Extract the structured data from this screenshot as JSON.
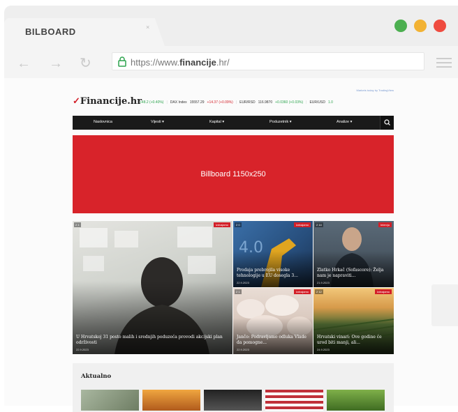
{
  "browser": {
    "tab_title": "BILBOARD",
    "tab_close": "×",
    "url_prefix": "https://www.",
    "url_domain": "financije",
    "url_suffix": ".hr/",
    "back": "←",
    "forward": "→",
    "reload": "↻",
    "dot_colors": [
      "#4caf50",
      "#f2b233",
      "#ef4b3f"
    ]
  },
  "site": {
    "ads_by": "Markets today by TradingView",
    "logo_text": "Financije.hr",
    "ticker": [
      {
        "label": "",
        "value": "",
        "change": "+48.2 (+0.40%)",
        "dir": "up"
      },
      {
        "label": "DAX Index",
        "value": "15557.29",
        "change": "+14.37 (+0.09%)",
        "dir": "down"
      },
      {
        "label": "EUR/RSD",
        "value": "116.9870",
        "change": "+0.0360 (+0.03%)",
        "dir": "up"
      },
      {
        "label": "EUR/USD",
        "value": "1.0",
        "change": "",
        "dir": "up"
      }
    ],
    "nav": [
      {
        "label": "Naslovnica"
      },
      {
        "label": "Vijesti ▾"
      },
      {
        "label": "Kapital ▾"
      },
      {
        "label": "Poduzetnik ▾"
      },
      {
        "label": "Analize ▾"
      }
    ],
    "search_icon": "search-icon",
    "billboard_text": "Billboard 1150x250",
    "tiles": [
      {
        "title": "U Hrvatskoj 31 posto malih i srednjih poduzeća provodi akcijski plan održivosti",
        "date": "22.9.2023",
        "badge": "Izdvajamo",
        "count": "2 1"
      },
      {
        "title": "Prodaja prebrojila visoke tehnologije u EU dosegla 3...",
        "date": "22.9.2023",
        "badge": "Izdvajamo",
        "count": "2 0"
      },
      {
        "title": "Zlatko Hrkač (Sofascore): Želja nam je napraviti...",
        "date": "21.9.2023",
        "badge": "Intervju",
        "count": "2 14"
      },
      {
        "title": "Jančo: Podravljamo odluka Vlade da pomogne...",
        "date": "22.9.2023",
        "badge": "Izdvajamo",
        "count": "2 1"
      },
      {
        "title": "Hrvatski vinari: Ove godine će urod biti manji, ali...",
        "date": "24.9.2023",
        "badge": "Izdvajamo",
        "count": "2 12"
      }
    ],
    "aktualno_title": "Aktualno"
  }
}
